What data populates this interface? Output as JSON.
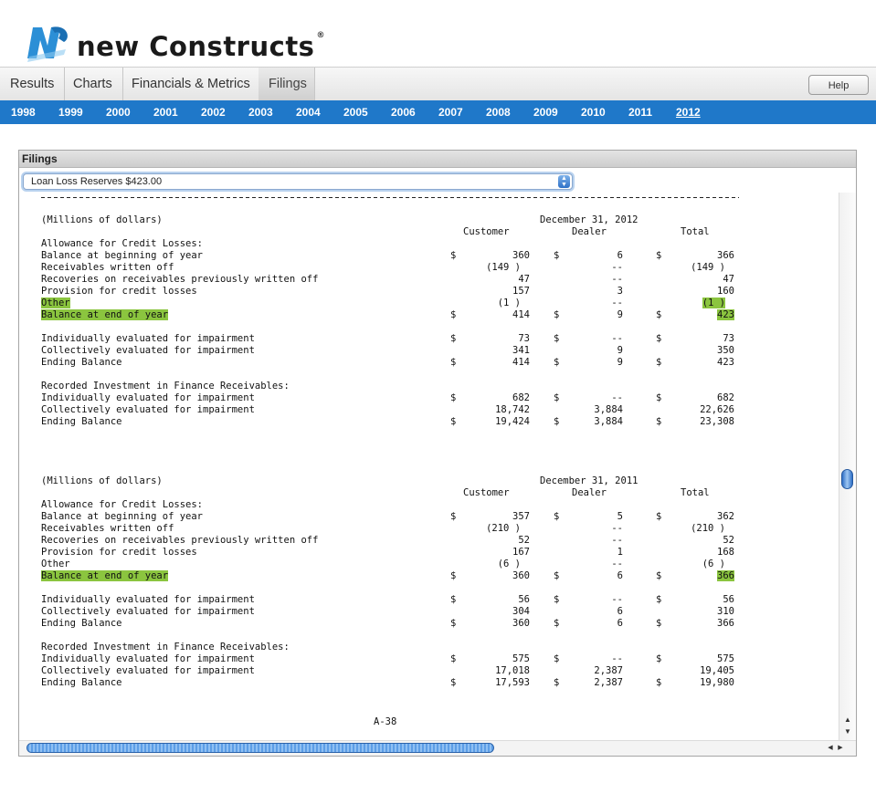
{
  "app": {
    "brand": "new Constructs",
    "brand_mark": "NC"
  },
  "tabs": [
    {
      "label": "Results"
    },
    {
      "label": "Charts"
    },
    {
      "label": "Financials & Metrics"
    },
    {
      "label": "Filings",
      "active": true
    }
  ],
  "help_label": "Help",
  "years": [
    "1998",
    "1999",
    "2000",
    "2001",
    "2002",
    "2003",
    "2004",
    "2005",
    "2006",
    "2007",
    "2008",
    "2009",
    "2010",
    "2011",
    "2012"
  ],
  "selected_year": "2012",
  "panel": {
    "title": "Filings",
    "select_value": "Loan Loss Reserves $423.00"
  },
  "document": {
    "page_footer": "A-38",
    "sections": [
      {
        "units": "(Millions of dollars)",
        "period": "December 31, 2012",
        "col_customer": "Customer",
        "col_dealer": "Dealer",
        "col_total": "Total",
        "groups": [
          {
            "heading": "Allowance for Credit Losses:",
            "rows": [
              {
                "label": "Balance at beginning of year",
                "dollar": true,
                "customer": "360",
                "dealer": "6",
                "total": "366"
              },
              {
                "label": "Receivables written off",
                "dollar": false,
                "customer": "(149 )",
                "dealer": "--",
                "total": "(149 )"
              },
              {
                "label": "Recoveries on receivables previously written off",
                "dollar": false,
                "customer": "47",
                "dealer": "--",
                "total": "47"
              },
              {
                "label": "Provision for credit losses",
                "dollar": false,
                "customer": "157",
                "dealer": "3",
                "total": "160"
              },
              {
                "label": "Other",
                "dollar": false,
                "customer": "(1 )",
                "dealer": "--",
                "total": "(1 )",
                "hl_label": true,
                "hl_total": true
              },
              {
                "label": "Balance at end of year",
                "dollar": true,
                "customer": "414",
                "dealer": "9",
                "total": "423",
                "hl_label": true,
                "hl_total": true
              }
            ]
          },
          {
            "heading": "",
            "rows": [
              {
                "label": "Individually evaluated for impairment",
                "dollar": true,
                "customer": "73",
                "dealer": "--",
                "total": "73"
              },
              {
                "label": "Collectively evaluated for impairment",
                "dollar": false,
                "customer": "341",
                "dealer": "9",
                "total": "350"
              },
              {
                "label": "Ending Balance",
                "dollar": true,
                "customer": "414",
                "dealer": "9",
                "total": "423"
              }
            ]
          },
          {
            "heading": "Recorded Investment in Finance Receivables:",
            "rows": [
              {
                "label": "Individually evaluated for impairment",
                "dollar": true,
                "customer": "682",
                "dealer": "--",
                "total": "682"
              },
              {
                "label": "Collectively evaluated for impairment",
                "dollar": false,
                "customer": "18,742",
                "dealer": "3,884",
                "total": "22,626"
              },
              {
                "label": "Ending Balance",
                "dollar": true,
                "customer": "19,424",
                "dealer": "3,884",
                "total": "23,308"
              }
            ]
          }
        ]
      },
      {
        "units": "(Millions of dollars)",
        "period": "December 31, 2011",
        "col_customer": "Customer",
        "col_dealer": "Dealer",
        "col_total": "Total",
        "groups": [
          {
            "heading": "Allowance for Credit Losses:",
            "rows": [
              {
                "label": "Balance at beginning of year",
                "dollar": true,
                "customer": "357",
                "dealer": "5",
                "total": "362"
              },
              {
                "label": "Receivables written off",
                "dollar": false,
                "customer": "(210 )",
                "dealer": "--",
                "total": "(210 )"
              },
              {
                "label": "Recoveries on receivables previously written off",
                "dollar": false,
                "customer": "52",
                "dealer": "--",
                "total": "52"
              },
              {
                "label": "Provision for credit losses",
                "dollar": false,
                "customer": "167",
                "dealer": "1",
                "total": "168"
              },
              {
                "label": "Other",
                "dollar": false,
                "customer": "(6 )",
                "dealer": "--",
                "total": "(6 )"
              },
              {
                "label": "Balance at end of year",
                "dollar": true,
                "customer": "360",
                "dealer": "6",
                "total": "366",
                "hl_label": true,
                "hl_total": true
              }
            ]
          },
          {
            "heading": "",
            "rows": [
              {
                "label": "Individually evaluated for impairment",
                "dollar": true,
                "customer": "56",
                "dealer": "--",
                "total": "56"
              },
              {
                "label": "Collectively evaluated for impairment",
                "dollar": false,
                "customer": "304",
                "dealer": "6",
                "total": "310"
              },
              {
                "label": "Ending Balance",
                "dollar": true,
                "customer": "360",
                "dealer": "6",
                "total": "366"
              }
            ]
          },
          {
            "heading": "Recorded Investment in Finance Receivables:",
            "rows": [
              {
                "label": "Individually evaluated for impairment",
                "dollar": true,
                "customer": "575",
                "dealer": "--",
                "total": "575"
              },
              {
                "label": "Collectively evaluated for impairment",
                "dollar": false,
                "customer": "17,018",
                "dealer": "2,387",
                "total": "19,405"
              },
              {
                "label": "Ending Balance",
                "dollar": true,
                "customer": "17,593",
                "dealer": "2,387",
                "total": "19,980"
              }
            ]
          }
        ]
      }
    ]
  },
  "currency_symbol": "$",
  "colors": {
    "accent": "#1f78c9",
    "highlight": "#8bc53f"
  }
}
